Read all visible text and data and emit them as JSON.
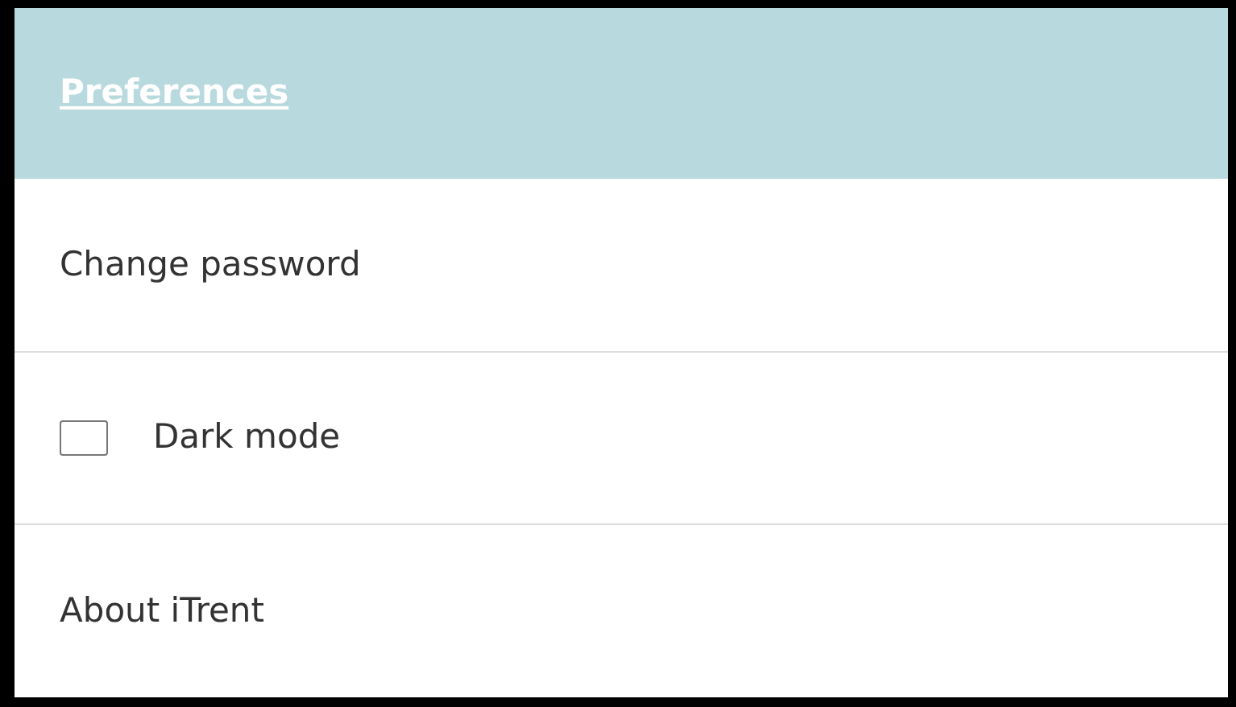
{
  "header": {
    "title": "Preferences"
  },
  "items": [
    {
      "kind": "link",
      "label": "Change password"
    },
    {
      "kind": "checkbox",
      "label": "Dark mode",
      "checked": false
    },
    {
      "kind": "link",
      "label": "About iTrent"
    }
  ]
}
